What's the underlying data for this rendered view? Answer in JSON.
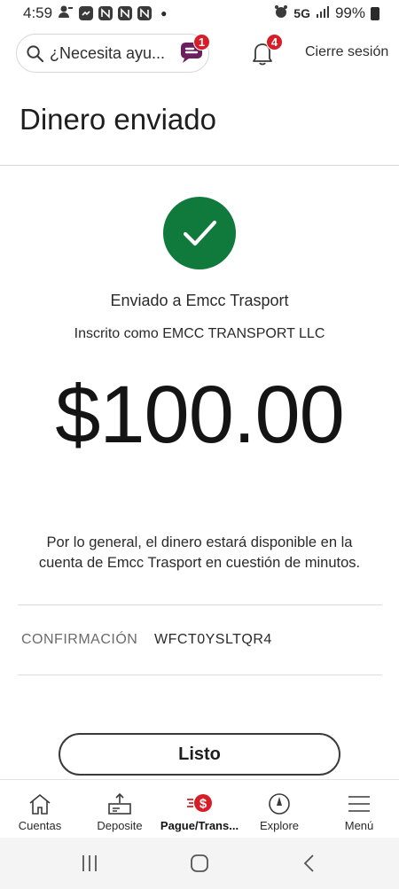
{
  "status_bar": {
    "time": "4:59",
    "network": "5G",
    "battery": "99%"
  },
  "header": {
    "search_placeholder": "¿Necesita ayu...",
    "assistant_badge": "1",
    "notifications_badge": "4",
    "logout_label": "Cierre sesión"
  },
  "page": {
    "title": "Dinero enviado",
    "sent_to": "Enviado a Emcc Trasport",
    "enrolled_as": "Inscrito como EMCC TRANSPORT LLC",
    "amount": "$100.00",
    "availability_note": "Por lo general, el dinero estará disponible en la cuenta de Emcc Trasport en cuestión de minutos.",
    "confirmation_label": "CONFIRMACIÓN",
    "confirmation_number": "WFCT0YSLTQR4",
    "done_label": "Listo"
  },
  "colors": {
    "success_green": "#0f7a3b",
    "badge_red": "#d71e28",
    "assistant_purple": "#6b1f5c"
  },
  "bottom_nav": {
    "items": [
      {
        "label": "Cuentas",
        "icon": "home-icon"
      },
      {
        "label": "Deposite",
        "icon": "deposit-icon"
      },
      {
        "label": "Pague/Trans...",
        "icon": "pay-transfer-icon",
        "active": true
      },
      {
        "label": "Explore",
        "icon": "compass-icon"
      },
      {
        "label": "Menú",
        "icon": "menu-icon"
      }
    ]
  },
  "system_nav": {
    "icons": [
      "recent-apps-icon",
      "home-circle-icon",
      "back-icon"
    ]
  }
}
